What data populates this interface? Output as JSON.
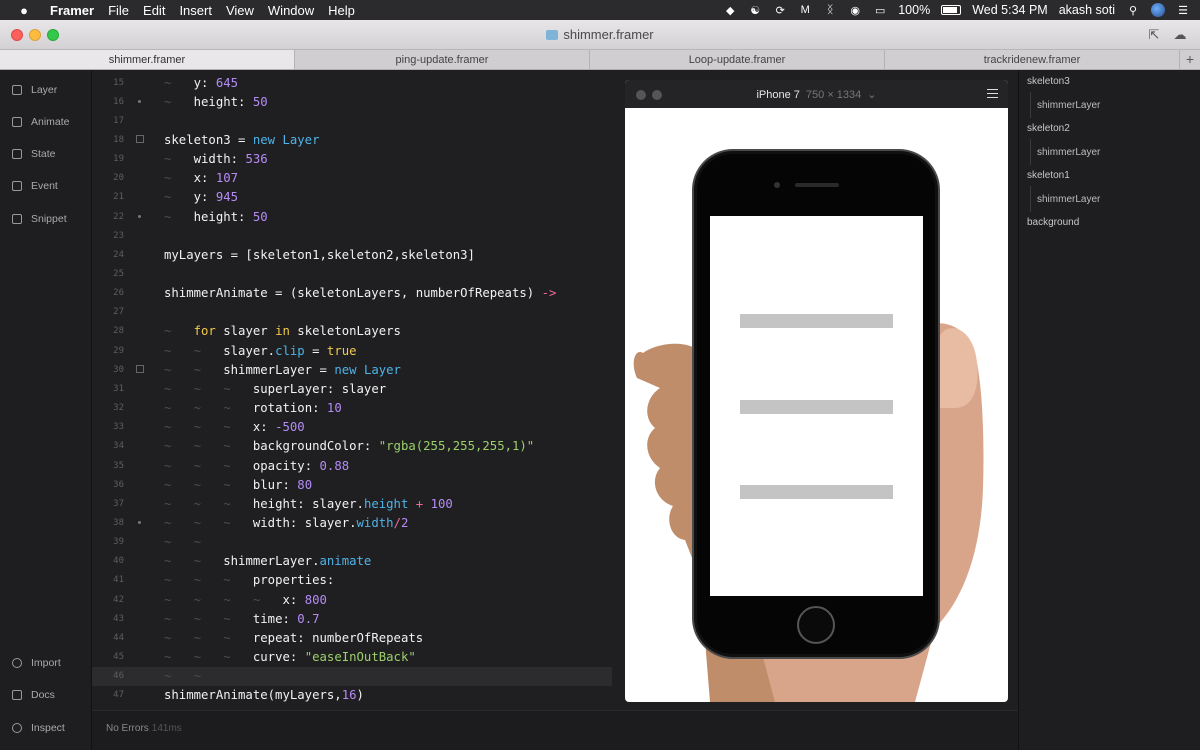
{
  "menubar": {
    "app_name": "Framer",
    "menus": [
      "File",
      "Edit",
      "Insert",
      "View",
      "Window",
      "Help"
    ],
    "battery": "100%",
    "clock": "Wed 5:34 PM",
    "user": "akash soti"
  },
  "window": {
    "title": "shimmer.framer"
  },
  "tabs": [
    {
      "label": "shimmer.framer"
    },
    {
      "label": "ping-update.framer"
    },
    {
      "label": "Loop-update.framer"
    },
    {
      "label": "trackridenew.framer"
    }
  ],
  "sidebar": {
    "top": [
      {
        "label": "Layer"
      },
      {
        "label": "Animate"
      },
      {
        "label": "State"
      },
      {
        "label": "Event"
      },
      {
        "label": "Snippet"
      }
    ],
    "bottom": [
      {
        "label": "Import"
      },
      {
        "label": "Docs"
      },
      {
        "label": "Inspect"
      }
    ]
  },
  "editor": {
    "lines": [
      {
        "n": "15",
        "ind": 1,
        "t": [
          [
            "y: ",
            ""
          ],
          [
            "645",
            "num"
          ]
        ]
      },
      {
        "n": "16",
        "ind": 1,
        "t": [
          [
            "height: ",
            ""
          ],
          [
            "50",
            "num"
          ]
        ]
      },
      {
        "n": "17",
        "ind": 0,
        "t": []
      },
      {
        "n": "18",
        "ind": 0,
        "t": [
          [
            "skeleton3 = ",
            ""
          ],
          [
            "new ",
            "nw"
          ],
          [
            "Layer",
            "cls"
          ]
        ]
      },
      {
        "n": "19",
        "ind": 1,
        "t": [
          [
            "width: ",
            ""
          ],
          [
            "536",
            "num"
          ]
        ]
      },
      {
        "n": "20",
        "ind": 1,
        "t": [
          [
            "x: ",
            ""
          ],
          [
            "107",
            "num"
          ]
        ]
      },
      {
        "n": "21",
        "ind": 1,
        "t": [
          [
            "y: ",
            ""
          ],
          [
            "945",
            "num"
          ]
        ]
      },
      {
        "n": "22",
        "ind": 1,
        "t": [
          [
            "height: ",
            ""
          ],
          [
            "50",
            "num"
          ]
        ]
      },
      {
        "n": "23",
        "ind": 0,
        "t": []
      },
      {
        "n": "24",
        "ind": 0,
        "t": [
          [
            "myLayers = [skeleton1,skeleton2,skeleton3]",
            ""
          ]
        ]
      },
      {
        "n": "25",
        "ind": 0,
        "t": []
      },
      {
        "n": "26",
        "ind": 0,
        "t": [
          [
            "shimmerAnimate = (skeletonLayers, numberOfRepeats) ",
            ""
          ],
          [
            "->",
            "op"
          ]
        ]
      },
      {
        "n": "27",
        "ind": 0,
        "t": []
      },
      {
        "n": "28",
        "ind": 1,
        "t": [
          [
            "for ",
            "kw"
          ],
          [
            "slayer ",
            ""
          ],
          [
            "in ",
            "kw"
          ],
          [
            "skeletonLayers",
            ""
          ]
        ]
      },
      {
        "n": "29",
        "ind": 2,
        "t": [
          [
            "slayer.",
            ""
          ],
          [
            "clip",
            "prop"
          ],
          [
            " = ",
            ""
          ],
          [
            "true",
            "bool"
          ]
        ]
      },
      {
        "n": "30",
        "ind": 2,
        "t": [
          [
            "shimmerLayer = ",
            ""
          ],
          [
            "new ",
            "nw"
          ],
          [
            "Layer",
            "cls"
          ]
        ]
      },
      {
        "n": "31",
        "ind": 3,
        "t": [
          [
            "superLayer: slayer",
            ""
          ]
        ]
      },
      {
        "n": "32",
        "ind": 3,
        "t": [
          [
            "rotation: ",
            ""
          ],
          [
            "10",
            "num"
          ]
        ]
      },
      {
        "n": "33",
        "ind": 3,
        "t": [
          [
            "x: ",
            ""
          ],
          [
            "-500",
            "num"
          ]
        ]
      },
      {
        "n": "34",
        "ind": 3,
        "t": [
          [
            "backgroundColor: ",
            ""
          ],
          [
            "\"rgba(255,255,255,1)\"",
            "str"
          ]
        ]
      },
      {
        "n": "35",
        "ind": 3,
        "t": [
          [
            "opacity: ",
            ""
          ],
          [
            "0.88",
            "num"
          ]
        ]
      },
      {
        "n": "36",
        "ind": 3,
        "t": [
          [
            "blur: ",
            ""
          ],
          [
            "80",
            "num"
          ]
        ]
      },
      {
        "n": "37",
        "ind": 3,
        "t": [
          [
            "height: slayer.",
            ""
          ],
          [
            "height",
            "prop"
          ],
          [
            " ",
            ""
          ],
          [
            "+",
            "op"
          ],
          [
            " ",
            ""
          ],
          [
            "100",
            "num"
          ]
        ]
      },
      {
        "n": "38",
        "ind": 3,
        "t": [
          [
            "width: slayer.",
            ""
          ],
          [
            "width",
            "prop"
          ],
          [
            "/",
            "op"
          ],
          [
            "2",
            "num"
          ]
        ]
      },
      {
        "n": "39",
        "ind": 2,
        "t": []
      },
      {
        "n": "40",
        "ind": 2,
        "t": [
          [
            "shimmerLayer.",
            ""
          ],
          [
            "animate",
            "prop"
          ]
        ]
      },
      {
        "n": "41",
        "ind": 3,
        "t": [
          [
            "properties:",
            ""
          ]
        ]
      },
      {
        "n": "42",
        "ind": 4,
        "t": [
          [
            "x: ",
            ""
          ],
          [
            "800",
            "num"
          ]
        ]
      },
      {
        "n": "43",
        "ind": 3,
        "t": [
          [
            "time: ",
            ""
          ],
          [
            "0.7",
            "num"
          ]
        ]
      },
      {
        "n": "44",
        "ind": 3,
        "t": [
          [
            "repeat: numberOfRepeats",
            ""
          ]
        ]
      },
      {
        "n": "45",
        "ind": 3,
        "t": [
          [
            "curve: ",
            ""
          ],
          [
            "\"easeInOutBack\"",
            "str"
          ]
        ]
      },
      {
        "n": "46",
        "ind": 2,
        "t": [],
        "hl": true
      },
      {
        "n": "47",
        "ind": 0,
        "t": [
          [
            "shimmerAnimate(myLayers,",
            ""
          ],
          [
            "16",
            "num"
          ],
          [
            ")",
            ""
          ]
        ]
      }
    ]
  },
  "status": {
    "message": "No Errors",
    "time": "141ms"
  },
  "preview": {
    "device": "iPhone 7",
    "resolution": "750 × 1334"
  },
  "layers": [
    {
      "label": "skeleton3",
      "level": 0
    },
    {
      "label": "shimmerLayer",
      "level": 1
    },
    {
      "label": "skeleton2",
      "level": 0
    },
    {
      "label": "shimmerLayer",
      "level": 1
    },
    {
      "label": "skeleton1",
      "level": 0
    },
    {
      "label": "shimmerLayer",
      "level": 1
    },
    {
      "label": "background",
      "level": 0
    }
  ]
}
